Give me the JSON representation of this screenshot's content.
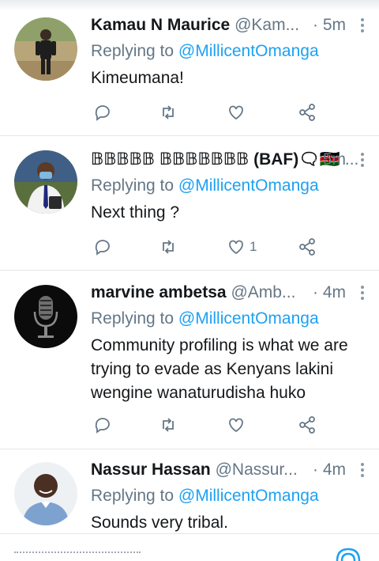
{
  "tweets": [
    {
      "name": "Kamau N Maurice",
      "handle": "@Kam...",
      "time": "· 5m",
      "reply_prefix": "Replying to ",
      "reply_to": "@MillicentOmanga",
      "text": "Kimeumana!",
      "likes": "",
      "avatar_icon": "person-outdoor-avatar"
    },
    {
      "name": "𝔹𝔹𝔹𝔹𝔹 𝔹𝔹𝔹𝔹𝔹𝔹𝔹 (BAF)🗨🇰🇪",
      "handle": "...",
      "time": "· 5m",
      "reply_prefix": "Replying to ",
      "reply_to": "@MillicentOmanga",
      "text": "Next thing ?",
      "likes": "1",
      "avatar_icon": "person-masked-avatar"
    },
    {
      "name": "marvine ambetsa",
      "handle": "@Amb...",
      "time": "· 4m",
      "reply_prefix": "Replying to ",
      "reply_to": "@MillicentOmanga",
      "text": "Community profiling is what we are trying to evade as Kenyans lakini wengine wanaturudisha huko",
      "likes": "",
      "avatar_icon": "microphone-avatar"
    },
    {
      "name": "Nassur Hassan",
      "handle": "@Nassur...",
      "time": "· 4m",
      "reply_prefix": "Replying to ",
      "reply_to": "@MillicentOmanga",
      "text": "Sounds very tribal.",
      "likes": "",
      "avatar_icon": "person-smiling-avatar"
    }
  ],
  "icons": {
    "reply": "reply-icon",
    "retweet": "retweet-icon",
    "like": "heart-icon",
    "share": "share-icon",
    "more": "more-vertical-icon"
  },
  "colors": {
    "link": "#1da1f2",
    "secondary_text": "#657786",
    "icon": "#657786",
    "divider": "#e3e6e8"
  }
}
